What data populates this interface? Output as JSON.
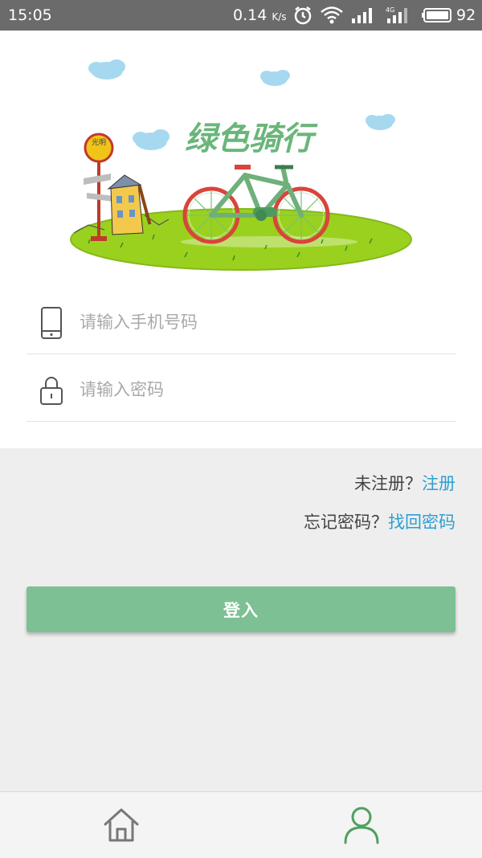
{
  "status_bar": {
    "time": "15:05",
    "network_speed": "0.14",
    "speed_unit": "K/s",
    "network_type": "4G",
    "battery_level": "92",
    "icons": [
      "alarm-icon",
      "wifi-icon",
      "signal-icon",
      "signal-4g-icon",
      "battery-icon"
    ]
  },
  "banner": {
    "title": "绿色骑行",
    "sign_text": "光明"
  },
  "form": {
    "phone_placeholder": "请输入手机号码",
    "password_placeholder": "请输入密码",
    "phone_icon": "phone-icon",
    "password_icon": "lock-icon"
  },
  "links": {
    "unregistered_text": "未注册？",
    "register_link": "注册",
    "forgot_text": "忘记密码？",
    "recover_link": "找回密码"
  },
  "login_button": "登入",
  "bottom_nav": {
    "items": [
      "home-icon",
      "user-icon"
    ],
    "active": "user-icon"
  },
  "colors": {
    "accent_green": "#7dc094",
    "link_blue": "#2f9fd0",
    "status_bar": "#6b6b6b",
    "nav_active": "#4fa05f",
    "nav_inactive": "#777777"
  }
}
